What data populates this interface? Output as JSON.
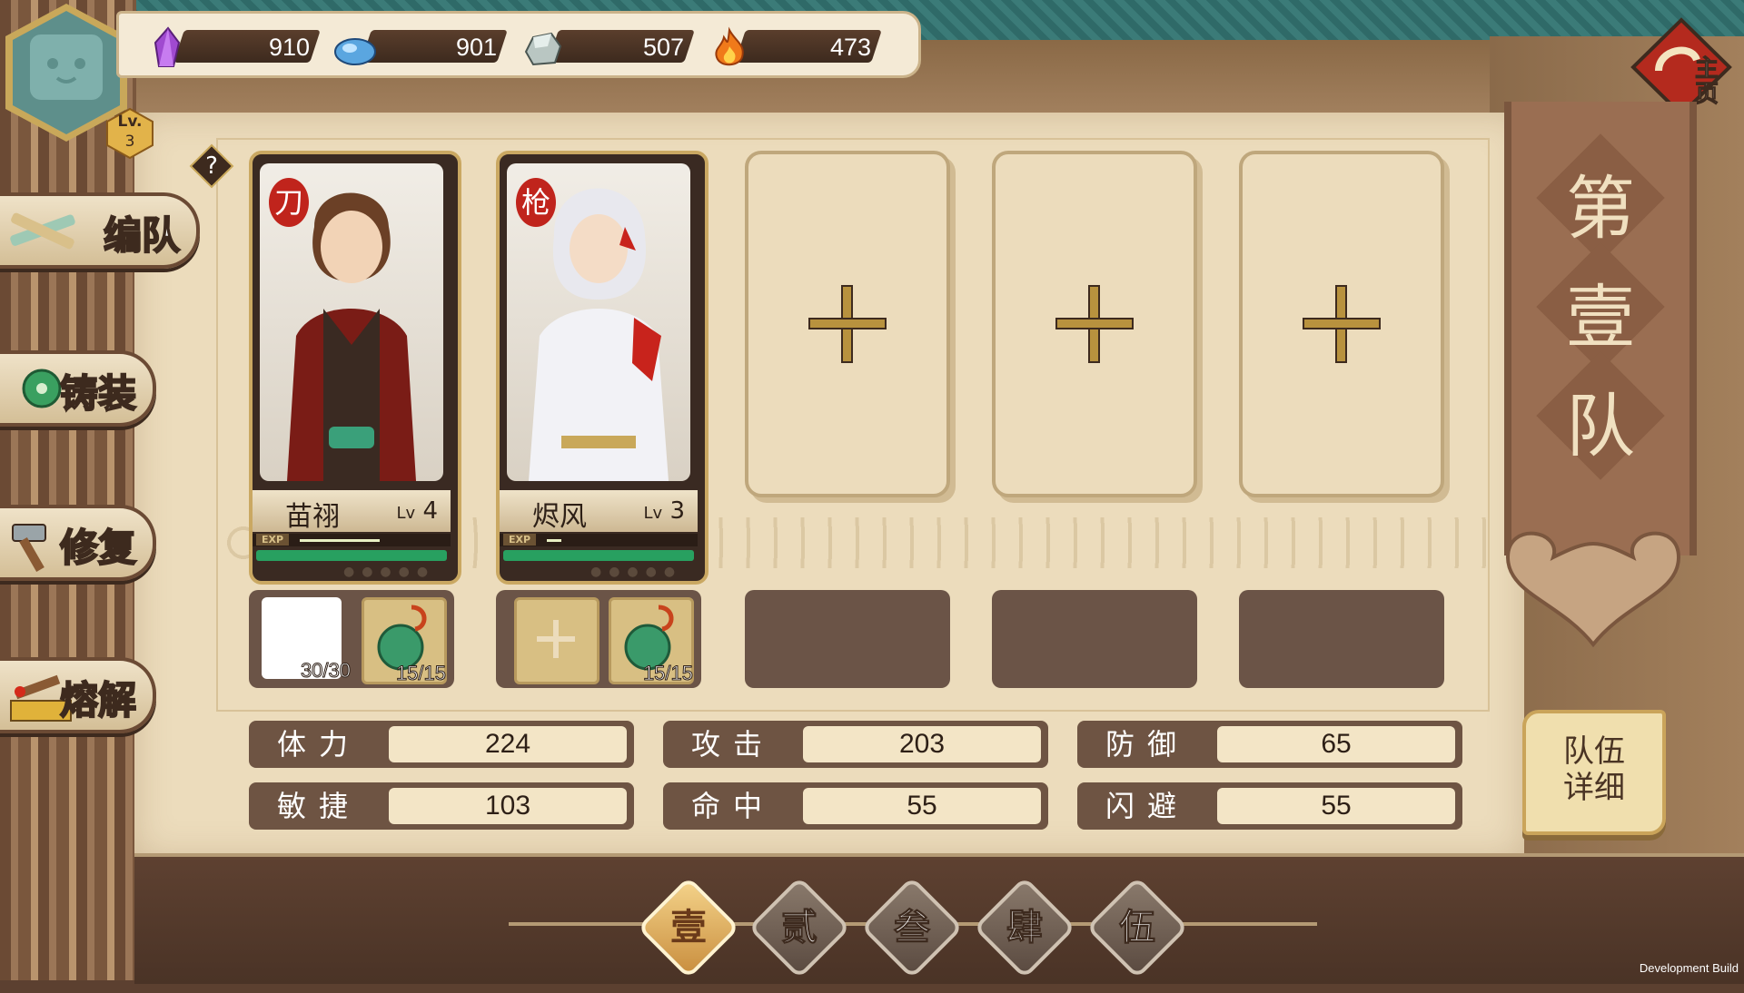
{
  "resources": [
    {
      "icon": "purple-crystal-icon",
      "value": "910"
    },
    {
      "icon": "blue-crystal-icon",
      "value": "901"
    },
    {
      "icon": "stone-icon",
      "value": "507"
    },
    {
      "icon": "flame-icon",
      "value": "473"
    }
  ],
  "player": {
    "level_label": "Lv.",
    "level": "3"
  },
  "menu": [
    {
      "label": "编队",
      "icon": "formation-icon"
    },
    {
      "label": "铸装",
      "icon": "forge-icon"
    },
    {
      "label": "修复",
      "icon": "repair-hammer-icon"
    },
    {
      "label": "熔解",
      "icon": "smelt-icon"
    }
  ],
  "help": {
    "label": "?"
  },
  "home": {
    "label": "主页"
  },
  "team_banner": {
    "chars": [
      "第",
      "壹",
      "队"
    ]
  },
  "cards": [
    {
      "name": "苗祤",
      "lv_prefix": "Lv",
      "level": "4",
      "weapon_stamp": "刀",
      "exp_label": "EXP",
      "exp_fraction": 0.55,
      "slots": [
        {
          "type": "blank",
          "count": "30/30"
        },
        {
          "type": "charm",
          "count": "15/15"
        }
      ]
    },
    {
      "name": "烬风",
      "lv_prefix": "Lv",
      "level": "3",
      "weapon_stamp": "枪",
      "exp_label": "EXP",
      "exp_fraction": 0.1,
      "slots": [
        {
          "type": "empty"
        },
        {
          "type": "charm",
          "count": "15/15"
        }
      ]
    }
  ],
  "stats": [
    {
      "label": "体力",
      "value": "224"
    },
    {
      "label": "攻击",
      "value": "203"
    },
    {
      "label": "防御",
      "value": "65"
    },
    {
      "label": "敏捷",
      "value": "103"
    },
    {
      "label": "命中",
      "value": "55"
    },
    {
      "label": "闪避",
      "value": "55"
    }
  ],
  "team_detail": {
    "line1": "队伍",
    "line2": "详细"
  },
  "team_tabs": [
    "壹",
    "贰",
    "叁",
    "肆",
    "伍"
  ],
  "active_tab": 0,
  "dev_label": "Development Build",
  "colors": {
    "accent": "#caa862",
    "panel": "#ecdcbc",
    "hp": "#28a060",
    "stamp": "#c0241c"
  }
}
